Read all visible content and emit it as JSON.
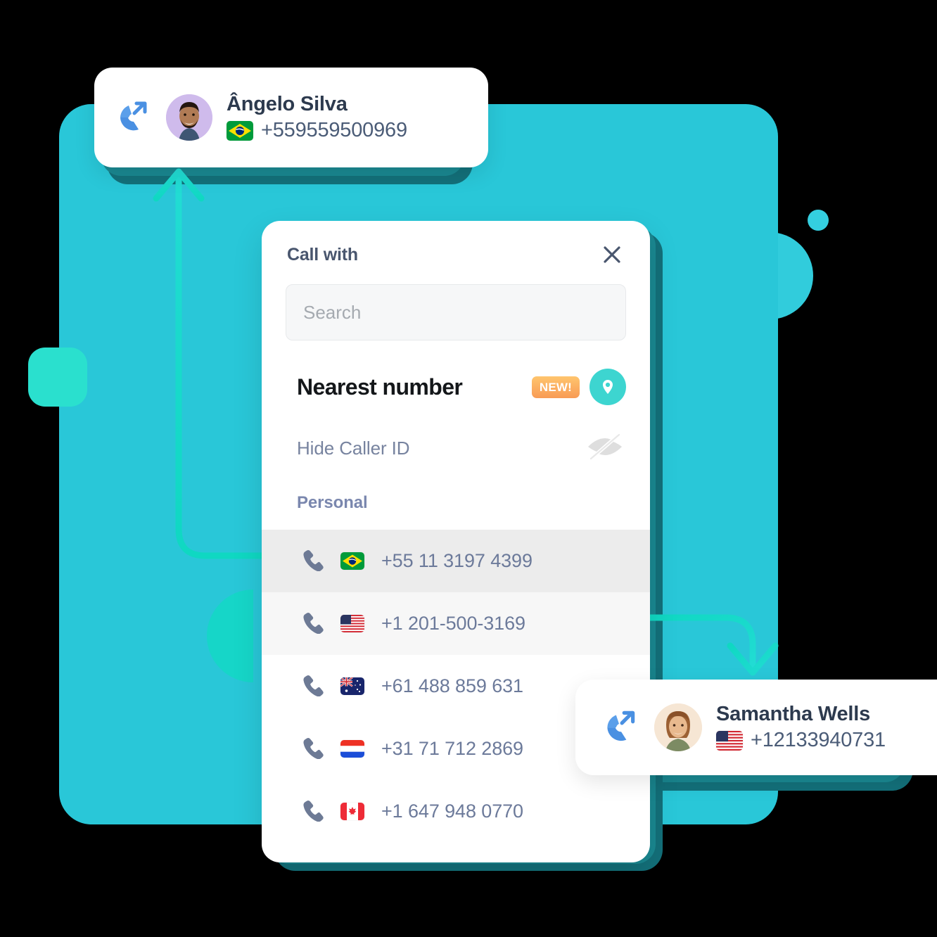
{
  "colors": {
    "bg_panel": "#29C7D8",
    "accent_teal": "#16D6C8",
    "mint": "#2AE0CE",
    "badge_orange_start": "#FFC56E",
    "badge_orange_end": "#F89B55",
    "pin_teal": "#3DD5D0",
    "call_icon_blue": "#4A90E2",
    "text_dark": "#2D3A4E",
    "text_muted": "#77839F",
    "row_selected": "#ECECEC",
    "row_hover": "#F7F7F7"
  },
  "cards": [
    {
      "id": "angelo",
      "icon": "outgoing-call-icon",
      "avatar": "avatar-angelo",
      "name": "Ângelo Silva",
      "flag": "br",
      "flag_label": "Brazil",
      "phone": "+559559500969"
    },
    {
      "id": "samantha",
      "icon": "outgoing-call-icon",
      "avatar": "avatar-samantha",
      "name": "Samantha Wells",
      "flag": "us",
      "flag_label": "United States",
      "phone": "+12133940731"
    }
  ],
  "dialog": {
    "title": "Call with",
    "close_icon": "close-icon",
    "search": {
      "value": "",
      "placeholder": "Search",
      "icon": "search-input"
    },
    "nearest": {
      "title": "Nearest number",
      "badge": "NEW!",
      "pin_icon": "location-pin-icon"
    },
    "hide_caller_id": {
      "label": "Hide Caller ID",
      "icon": "eye-slash-icon"
    },
    "section_label": "Personal",
    "numbers": [
      {
        "flag": "br",
        "flag_label": "Brazil",
        "number": "+55 11 3197 4399",
        "state": "selected",
        "icon": "phone-icon"
      },
      {
        "flag": "us",
        "flag_label": "United States",
        "number": "+1 201-500-3169",
        "state": "hover",
        "icon": "phone-icon"
      },
      {
        "flag": "au",
        "flag_label": "Australia",
        "number": "+61 488 859 631",
        "state": "normal",
        "icon": "phone-icon"
      },
      {
        "flag": "nl",
        "flag_label": "Netherlands",
        "number": "+31 71 712 2869",
        "state": "normal",
        "icon": "phone-icon"
      },
      {
        "flag": "ca",
        "flag_label": "Canada",
        "number": "+1 647 948 0770",
        "state": "normal",
        "icon": "phone-icon"
      }
    ]
  }
}
